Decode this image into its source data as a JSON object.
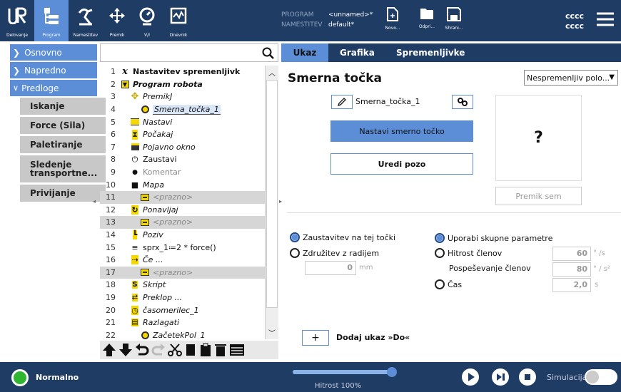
{
  "topbar": {
    "buttons": [
      {
        "label": "Delovanje",
        "icon": "ur-logo-icon"
      },
      {
        "label": "Program",
        "icon": "program-icon"
      },
      {
        "label": "Namestitev",
        "icon": "installation-icon"
      },
      {
        "label": "Premik",
        "icon": "move-icon"
      },
      {
        "label": "V/I",
        "icon": "io-icon"
      },
      {
        "label": "Dnevnik",
        "icon": "log-icon"
      }
    ],
    "program_key": "PROGRAM",
    "program_value": "<unnamed>*",
    "install_key": "NAMESTITEV",
    "install_value": "default*",
    "file_buttons": {
      "new": "Novo...",
      "open": "Odpri...",
      "save": "Shrani..."
    },
    "cccc_line1": "cccc",
    "cccc_line2": "cccc"
  },
  "nav": {
    "basic": "Osnovno",
    "advanced": "Napredno",
    "templates": "Predloge",
    "sub_items": [
      "Iskanje",
      "Force (Sila)",
      "Paletiranje",
      "Sledenje transportne...",
      "Privijanje"
    ]
  },
  "tree": {
    "rows": [
      {
        "n": "1",
        "text": "Nastavitev spremenljivk",
        "icon": "x-variable-icon",
        "indent": 0,
        "bold": true
      },
      {
        "n": "2",
        "text": "Program robota",
        "icon": "flag-icon",
        "indent": 0,
        "bold": true,
        "italic": true
      },
      {
        "n": "3",
        "text": "PremikJ",
        "icon": "move-icon",
        "indent": 1,
        "italic": true
      },
      {
        "n": "4",
        "text": "Smerna_točka_1",
        "icon": "waypoint-icon",
        "indent": 2,
        "italic": true,
        "selected": true
      },
      {
        "n": "5",
        "text": "Nastavi",
        "icon": "set-icon",
        "indent": 1,
        "italic": true
      },
      {
        "n": "6",
        "text": "Počakaj",
        "icon": "hourglass-icon",
        "indent": 1,
        "italic": true
      },
      {
        "n": "7",
        "text": "Pojavno okno",
        "icon": "popup-icon",
        "indent": 1,
        "italic": true
      },
      {
        "n": "8",
        "text": "Zaustavi",
        "icon": "stop-icon",
        "indent": 1
      },
      {
        "n": "9",
        "text": "Komentar",
        "icon": "comment-icon",
        "indent": 1,
        "gray": true
      },
      {
        "n": "10",
        "text": "Mapa",
        "icon": "folder-icon",
        "indent": 1,
        "italic": true
      },
      {
        "n": "11",
        "text": "<prazno>",
        "icon": "empty-icon",
        "indent": 2,
        "italic": true,
        "gray": true,
        "hl": true
      },
      {
        "n": "12",
        "text": "Ponavljaj",
        "icon": "loop-icon",
        "indent": 1,
        "italic": true
      },
      {
        "n": "13",
        "text": "<prazno>",
        "icon": "empty-icon",
        "indent": 2,
        "italic": true,
        "gray": true,
        "hl": true
      },
      {
        "n": "14",
        "text": "Poziv",
        "icon": "call-icon",
        "indent": 1,
        "italic": true
      },
      {
        "n": "15",
        "text": "sprx_1≔2 * force()",
        "icon": "assignment-icon",
        "indent": 1
      },
      {
        "n": "16",
        "text": "Če ...",
        "icon": "if-icon",
        "indent": 1,
        "italic": true
      },
      {
        "n": "17",
        "text": "<prazno>",
        "icon": "empty-icon",
        "indent": 2,
        "italic": true,
        "gray": true,
        "hl": true
      },
      {
        "n": "18",
        "text": "Skript",
        "icon": "script-icon",
        "indent": 1,
        "italic": true
      },
      {
        "n": "19",
        "text": "Preklop ...",
        "icon": "switch-icon",
        "indent": 1,
        "italic": true
      },
      {
        "n": "20",
        "text": "časomerilec_1",
        "icon": "timer-icon",
        "indent": 1,
        "italic": true
      },
      {
        "n": "21",
        "text": "Razlagati",
        "icon": "interpret-icon",
        "indent": 1,
        "italic": true
      },
      {
        "n": "22",
        "text": "ZačetekPol_1",
        "icon": "waypoint-icon",
        "indent": 2,
        "italic": true
      }
    ]
  },
  "tabs": [
    "Ukaz",
    "Grafika",
    "Spremenljivke"
  ],
  "command": {
    "title": "Smerna točka",
    "dropdown": "Nespremenljiv polo...",
    "waypoint_name": "Smerna_točka_1",
    "set_waypoint": "Nastavi smerno točko",
    "edit_pose": "Uredi pozo",
    "question": "?",
    "move_here": "Premik sem",
    "stop_at_point": "Zaustavitev na tej točki",
    "blend_radius": "Združitev z radijem",
    "radius_value": "0",
    "radius_unit": "mm",
    "use_shared": "Uporabi skupne parametre",
    "joint_speed": "Hitrost členov",
    "joint_speed_value": "60",
    "joint_speed_unit": "° /s",
    "joint_accel": "Pospeševanje členov",
    "joint_accel_value": "80",
    "joint_accel_unit": "° / s²",
    "time": "Čas",
    "time_value": "2,0",
    "time_unit": "s",
    "add_until": "Dodaj ukaz »Do«",
    "plus": "+"
  },
  "footer": {
    "status": "Normalno",
    "speed": "Hitrost 100%",
    "speed_fraction": 1.0,
    "simulation": "Simulacija"
  },
  "colors": {
    "navy": "#1e3c64",
    "accent": "#5b8ed7",
    "yellow": "#f5d800",
    "green": "#2fb52f"
  }
}
